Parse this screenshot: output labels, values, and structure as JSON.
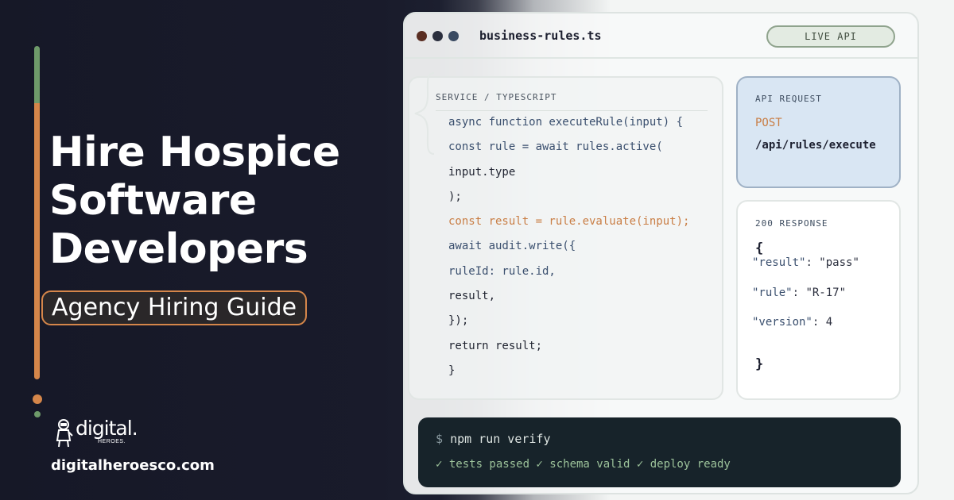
{
  "headline": {
    "lines": [
      "Hire Hospice",
      "Software",
      "Developers"
    ],
    "badge": "Agency Hiring Guide"
  },
  "brand": {
    "name": "digital.",
    "sub": "HEROES.",
    "url": "digitalheroesco.com"
  },
  "editor": {
    "file_name": "business-rules.ts",
    "live_badge": "LIVE API",
    "code_label": "SERVICE / TYPESCRIPT",
    "code_lines": [
      "async function executeRule(input) {",
      "const rule = await rules.active(",
      "input.type",
      ");",
      "const result = rule.evaluate(input);",
      "await audit.write({",
      "ruleId: rule.id,",
      "result,",
      "});",
      "return result;",
      "}"
    ]
  },
  "request": {
    "label": "API REQUEST",
    "method": "POST",
    "path": "/api/rules/execute"
  },
  "response": {
    "label": "200 RESPONSE",
    "open_brace": "{",
    "close_brace": "}",
    "rows": [
      {
        "key": "\"result\"",
        "sep": ": ",
        "value": "\"pass\""
      },
      {
        "key": "\"rule\"",
        "sep": ": ",
        "value": "\"R-17\""
      },
      {
        "key": "\"version\"",
        "sep": ": ",
        "value": "4"
      }
    ]
  },
  "terminal": {
    "prompt": "$",
    "command": "npm run verify",
    "output": "✓ tests passed ✓ schema valid ✓ deploy ready"
  },
  "colors": {
    "dark_bg": "#191b2b",
    "accent_orange": "#d5864a",
    "accent_green": "#6e9a6a",
    "request_bg": "#d9e6f3",
    "terminal_bg": "#17232a"
  }
}
